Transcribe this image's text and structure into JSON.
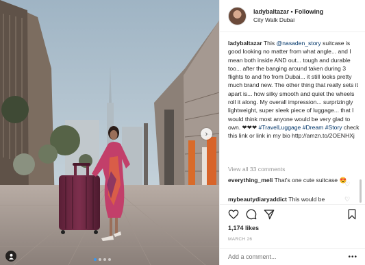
{
  "post": {
    "username": "ladybaltazar",
    "separator": "•",
    "follow_label": "Following",
    "location": "City Walk Dubai"
  },
  "caption": {
    "username": "ladybaltazar",
    "text_1": " This ",
    "mention": "@nasaden_story",
    "text_2": " suitcase is good looking no matter from what angle... and I mean both inside AND out... tough and durable too... after the banging around taken during 3 flights to and fro from Dubai... it still looks pretty much brand new. The other thing that really sets it apart is... how silky smooth and quiet the wheels roll it along. My overall impression... surprizingly lightweight, super sleek piece of luggage... that I would think most anyone would be very glad to own. ❤❤❤ ",
    "hashtag_1": "#TravelLuggage",
    "hashtag_2": "#Dream",
    "hashtag_3": "#Story",
    "text_3": " check this link or link in my bio http://amzn.to/2OENHXj"
  },
  "view_all_label": "View all 33 comments",
  "comments": [
    {
      "username": "everything_meli",
      "text": " That's one cute suitcase 😍"
    },
    {
      "username": "mybeautydiaryaddict",
      "text": " This would be"
    }
  ],
  "likes_label": "1,174 likes",
  "date_label": "MARCH 26",
  "add_comment_placeholder": "Add a comment...",
  "more_label": "•••",
  "colors": {
    "link": "#003569",
    "accent": "#3897f0",
    "muted": "#999999",
    "border": "#efefef"
  },
  "icons": [
    "next-arrow-icon",
    "user-tag-icon",
    "heart-icon",
    "comment-icon",
    "share-icon",
    "bookmark-icon"
  ]
}
